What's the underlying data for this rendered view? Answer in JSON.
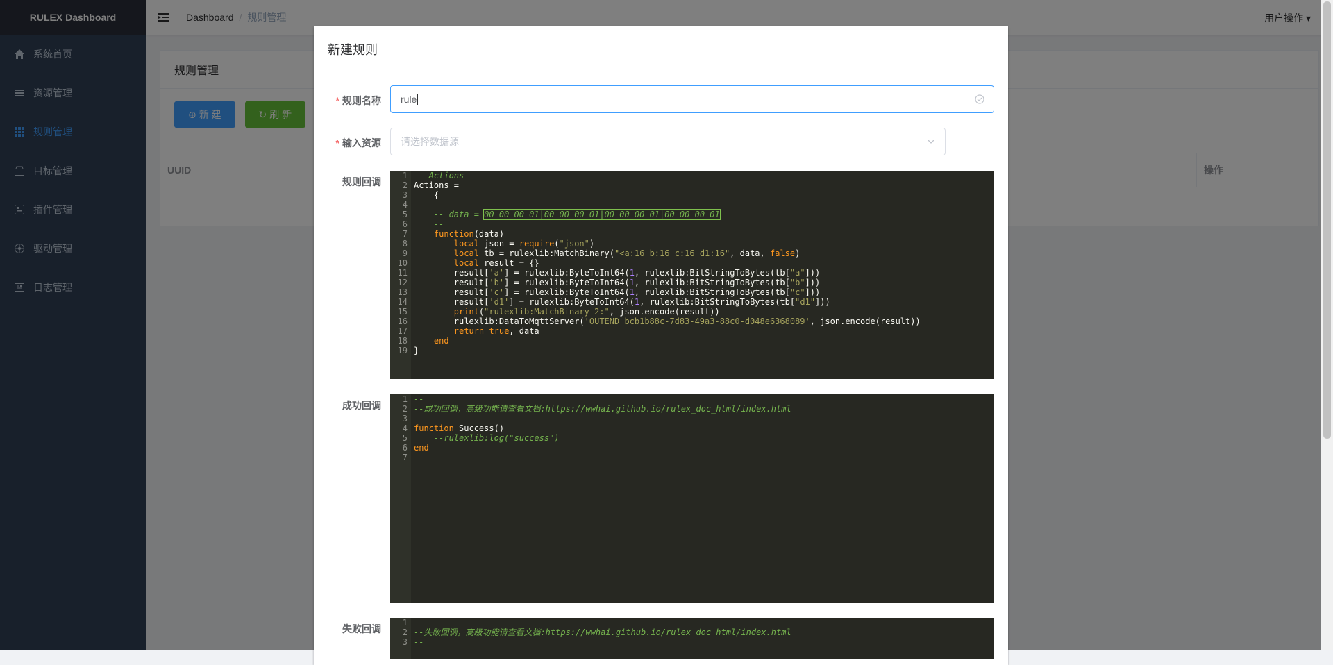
{
  "sidebar": {
    "brand": "RULEX Dashboard",
    "items": [
      {
        "label": "系统首页",
        "icon": "home-icon"
      },
      {
        "label": "资源管理",
        "icon": "list-icon"
      },
      {
        "label": "规则管理",
        "icon": "grid-icon",
        "active": true
      },
      {
        "label": "目标管理",
        "icon": "archive-icon"
      },
      {
        "label": "插件管理",
        "icon": "plugin-icon"
      },
      {
        "label": "驱动管理",
        "icon": "driver-icon"
      },
      {
        "label": "日志管理",
        "icon": "log-icon"
      }
    ]
  },
  "header": {
    "breadcrumb_root": "Dashboard",
    "breadcrumb_separator": "/",
    "breadcrumb_current": "规则管理",
    "user_menu": "用户操作"
  },
  "page": {
    "card_title": "规则管理",
    "new_button": "新 建",
    "refresh_button": "刷 新",
    "table_col_uuid": "UUID",
    "table_col_ops": "操作"
  },
  "modal": {
    "title": "新建规则",
    "name_label": "规则名称",
    "name_value": "rule",
    "source_label": "输入资源",
    "source_placeholder": "请选择数据源",
    "action_label": "规则回调",
    "success_label": "成功回调",
    "failed_label": "失败回调",
    "action_code": [
      "-- Actions",
      "Actions =",
      "    {",
      "    --",
      "    -- data = 00 00 00 01|00 00 00 01|00 00 00 01|00 00 00 01",
      "    --",
      "    function(data)",
      "        local json = require(\"json\")",
      "        local tb = rulexlib:MatchBinary(\"<a:16 b:16 c:16 d1:16\", data, false)",
      "        local result = {}",
      "        result['a'] = rulexlib:ByteToInt64(1, rulexlib:BitStringToBytes(tb[\"a\"]))",
      "        result['b'] = rulexlib:ByteToInt64(1, rulexlib:BitStringToBytes(tb[\"b\"]))",
      "        result['c'] = rulexlib:ByteToInt64(1, rulexlib:BitStringToBytes(tb[\"c\"]))",
      "        result['d1'] = rulexlib:ByteToInt64(1, rulexlib:BitStringToBytes(tb[\"d1\"]))",
      "        print(\"rulexlib:MatchBinary 2:\", json.encode(result))",
      "        rulexlib:DataToMqttServer('OUTEND_bcb1b88c-7d83-49a3-88c0-d048e6368089', json.encode(result))",
      "        return true, data",
      "    end",
      "}"
    ],
    "success_code": [
      "--",
      "--成功回调，高级功能请查看文档:https://wwhai.github.io/rulex_doc_html/index.html",
      "--",
      "function Success()",
      "    --rulexlib:log(\"success\")",
      "end",
      ""
    ],
    "failed_code": [
      "--",
      "--失败回调，高级功能请查看文档:https://wwhai.github.io/rulex_doc_html/index.html",
      "--"
    ]
  }
}
